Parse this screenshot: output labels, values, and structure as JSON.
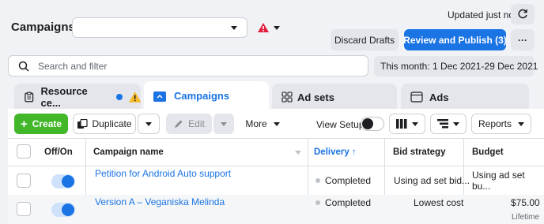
{
  "header": {
    "title": "Campaigns",
    "campaign_select_value": "",
    "updated_text": "Updated just now",
    "discard_label": "Discard Drafts",
    "review_publish_label": "Review and Publish (3)",
    "more_label": "···"
  },
  "search": {
    "placeholder": "Search and filter",
    "date_range": "This month: 1 Dec 2021-29 Dec 2021"
  },
  "tabs": [
    {
      "label": "Resource ce..."
    },
    {
      "label": "Campaigns"
    },
    {
      "label": "Ad sets"
    },
    {
      "label": "Ads"
    }
  ],
  "toolbar": {
    "create_label": "Create",
    "duplicate_label": "Duplicate",
    "edit_label": "Edit",
    "more_label": "More",
    "view_setup_label": "View Setup",
    "reports_label": "Reports"
  },
  "table": {
    "columns": {
      "onoff": "Off/On",
      "name": "Campaign name",
      "delivery": "Delivery ↑",
      "bid": "Bid strategy",
      "budget": "Budget"
    },
    "rows": [
      {
        "name": "Petition for Android Auto support",
        "delivery": "Completed",
        "bid": "Using ad set bid...",
        "budget": "Using ad set bu...",
        "budget_sub": ""
      },
      {
        "name": "Version A – Veganiska Melinda",
        "delivery": "Completed",
        "bid": "Lowest cost",
        "budget": "$75.00",
        "budget_sub": "Lifetime"
      }
    ]
  },
  "colors": {
    "accent": "#1b74e4",
    "create": "#42b72a",
    "warning": "#e41e3f",
    "warning_triangle": "#f7b928"
  }
}
